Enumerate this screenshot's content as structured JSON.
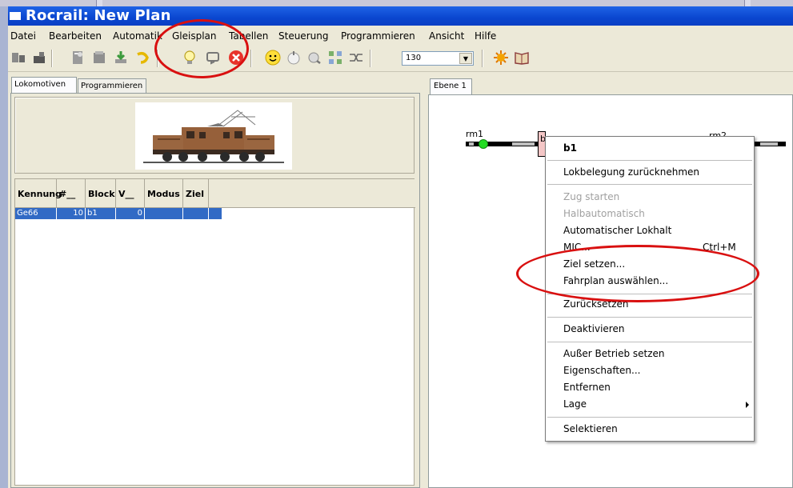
{
  "window": {
    "title": "Rocrail: New Plan"
  },
  "menubar": {
    "items": [
      "Datei",
      "Bearbeiten",
      "Automatik",
      "Gleisplan",
      "Tabellen",
      "Steuerung",
      "Programmieren",
      "Ansicht",
      "Hilfe"
    ]
  },
  "toolbar": {
    "icons": [
      "connect-icon",
      "disconnect-icon",
      "new-plan-icon",
      "open-plan-icon",
      "save-plan-icon",
      "undo-icon",
      "power-on-icon",
      "emergency-break-icon",
      "stop-all-icon",
      "auto-mode-icon",
      "go-icon",
      "lock-icon",
      "layout-icon",
      "shuffle-icon",
      "settings-icon",
      "help-book-icon"
    ],
    "zoom_value": "130"
  },
  "left_panel": {
    "tabs": [
      "Lokomotiven",
      "Programmieren"
    ],
    "table": {
      "columns": [
        "Kennung",
        "#__",
        "Block",
        "V__",
        "Modus",
        "Ziel"
      ],
      "rows": [
        {
          "kennung": "Ge66",
          "nr": "10",
          "block": "b1",
          "v": "0",
          "modus": "",
          "ziel": ""
        }
      ]
    }
  },
  "right_panel": {
    "tab": "Ebene 1",
    "labels": {
      "sensor1": "rm1",
      "sensor2": "rm2",
      "block": "b"
    }
  },
  "context_menu": {
    "header": "b1",
    "items": {
      "release": "Lokbelegung zurücknehmen",
      "start_train": "Zug starten",
      "half_auto": "Halbautomatisch",
      "auto_stop": "Automatischer Lokhalt",
      "mic": "MIC...",
      "mic_shortcut": "Ctrl+M",
      "set_target": "Ziel setzen...",
      "choose_schedule": "Fahrplan auswählen...",
      "reset": "Zurücksetzen",
      "deactivate": "Deaktivieren",
      "out_of_service": "Außer Betrieb setzen",
      "properties": "Eigenschaften...",
      "remove": "Entfernen",
      "position": "Lage",
      "select": "Selektieren"
    }
  },
  "colors": {
    "titlebar": "#0a46cf",
    "selection": "#316ac5",
    "annotation": "#d91010",
    "sensor_on": "#22dd22",
    "block_fill": "#f4c6c6"
  }
}
